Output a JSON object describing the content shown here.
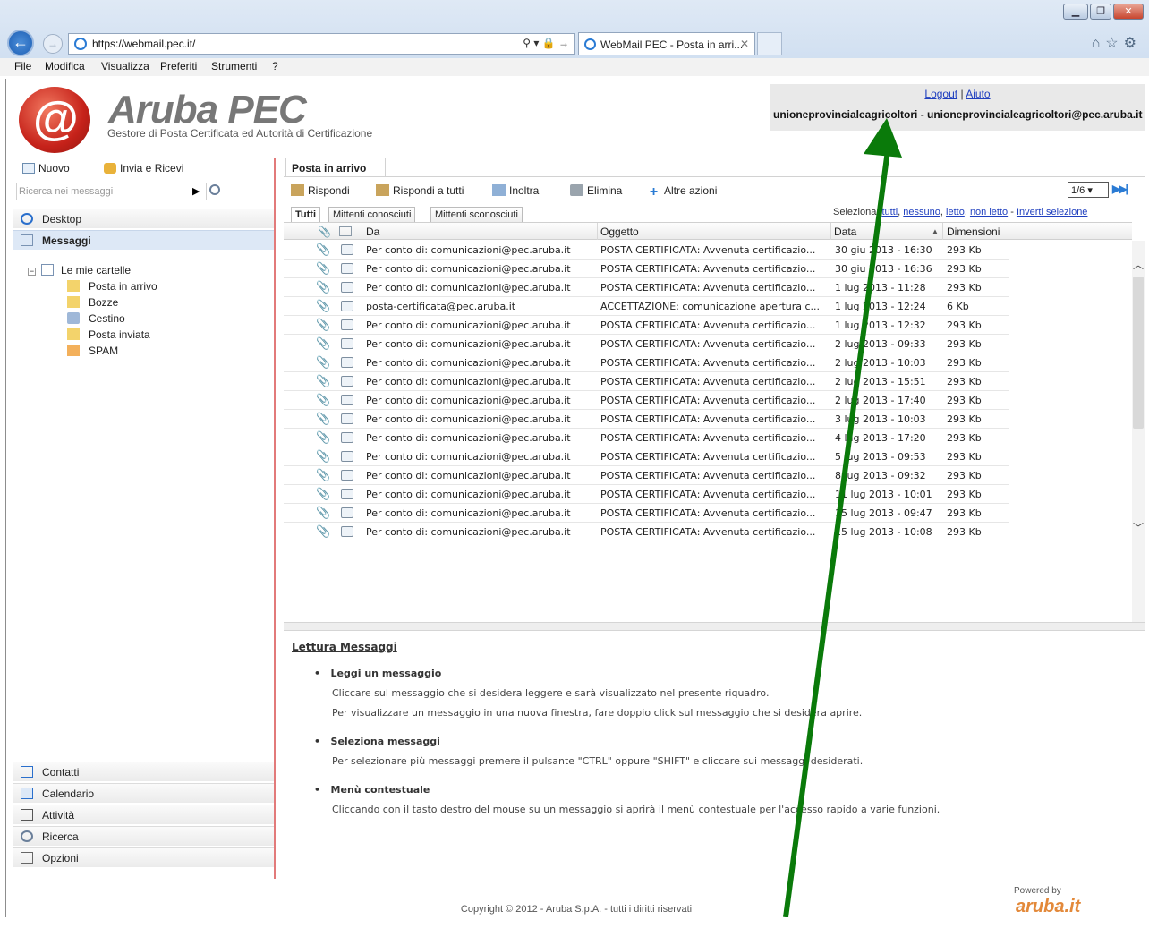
{
  "browser": {
    "url": "https://webmail.pec.it/",
    "addr_tools": "⚲ ▾ 🔒 →",
    "tab_title": "WebMail PEC - Posta in arri...",
    "tab_close": "✕",
    "right_icons": "⌂☆⚙",
    "win_min": "▁",
    "win_max": "❐",
    "win_close": "✕",
    "menu": [
      "File",
      "Modifica",
      "Visualizza",
      "Preferiti",
      "Strumenti",
      "?"
    ]
  },
  "logo": {
    "name": "Aruba PEC",
    "tagline": "Gestore di Posta Certificata ed Autorità di Certificazione"
  },
  "user": {
    "logout": "Logout",
    "sep": "|",
    "help": "Aiuto",
    "account": "unioneprovincialeagricoltori - unioneprovincialeagricoltori@pec.aruba.it"
  },
  "left": {
    "new_label": "Nuovo",
    "send_receive_label": "Invia e Ricevi",
    "search_placeholder": "Ricerca nei messaggi",
    "search_go": "▶",
    "nav_desktop": "Desktop",
    "nav_messaggi": "Messaggi",
    "tree_root": "Le mie cartelle",
    "folders": [
      "Posta in arrivo",
      "Bozze",
      "Cestino",
      "Posta inviata",
      "SPAM"
    ],
    "bottom_nav": [
      "Contatti",
      "Calendario",
      "Attività",
      "Ricerca",
      "Opzioni"
    ]
  },
  "main": {
    "tab": "Posta in arrivo",
    "toolbar": [
      "Rispondi",
      "Rispondi a tutti",
      "Inoltra",
      "Elimina",
      "Altre azioni"
    ],
    "pager": "1/6",
    "pager_select": "▾",
    "pager_next": "▶▶|",
    "subtabs": [
      "Tutti",
      "Mittenti conosciuti",
      "Mittenti sconosciuti"
    ],
    "select_prefix": "Seleziona:",
    "select_links": [
      "tutti",
      "nessuno",
      "letto",
      "non letto"
    ],
    "select_dash": "-",
    "invert": "Inverti selezione",
    "columns": {
      "from": "Da",
      "subject": "Oggetto",
      "date": "Data",
      "size": "Dimensioni",
      "sort": "▲"
    },
    "scroll_up": "︿",
    "scroll_down": "﹀"
  },
  "messages": [
    {
      "from": "Per conto di: comunicazioni@pec.aruba.it",
      "subject": "POSTA CERTIFICATA: Avvenuta certificazio...",
      "date": "30 giu 2013 - 16:30",
      "size": "293 Kb"
    },
    {
      "from": "Per conto di: comunicazioni@pec.aruba.it",
      "subject": "POSTA CERTIFICATA: Avvenuta certificazio...",
      "date": "30 giu 2013 - 16:36",
      "size": "293 Kb"
    },
    {
      "from": "Per conto di: comunicazioni@pec.aruba.it",
      "subject": "POSTA CERTIFICATA: Avvenuta certificazio...",
      "date": "1 lug 2013 - 11:28",
      "size": "293 Kb"
    },
    {
      "from": "posta-certificata@pec.aruba.it",
      "subject": "ACCETTAZIONE: comunicazione apertura c...",
      "date": "1 lug 2013 - 12:24",
      "size": "6 Kb"
    },
    {
      "from": "Per conto di: comunicazioni@pec.aruba.it",
      "subject": "POSTA CERTIFICATA: Avvenuta certificazio...",
      "date": "1 lug 2013 - 12:32",
      "size": "293 Kb"
    },
    {
      "from": "Per conto di: comunicazioni@pec.aruba.it",
      "subject": "POSTA CERTIFICATA: Avvenuta certificazio...",
      "date": "2 lug 2013 - 09:33",
      "size": "293 Kb"
    },
    {
      "from": "Per conto di: comunicazioni@pec.aruba.it",
      "subject": "POSTA CERTIFICATA: Avvenuta certificazio...",
      "date": "2 lug 2013 - 10:03",
      "size": "293 Kb"
    },
    {
      "from": "Per conto di: comunicazioni@pec.aruba.it",
      "subject": "POSTA CERTIFICATA: Avvenuta certificazio...",
      "date": "2 lug 2013 - 15:51",
      "size": "293 Kb"
    },
    {
      "from": "Per conto di: comunicazioni@pec.aruba.it",
      "subject": "POSTA CERTIFICATA: Avvenuta certificazio...",
      "date": "2 lug 2013 - 17:40",
      "size": "293 Kb"
    },
    {
      "from": "Per conto di: comunicazioni@pec.aruba.it",
      "subject": "POSTA CERTIFICATA: Avvenuta certificazio...",
      "date": "3 lug 2013 - 10:03",
      "size": "293 Kb"
    },
    {
      "from": "Per conto di: comunicazioni@pec.aruba.it",
      "subject": "POSTA CERTIFICATA: Avvenuta certificazio...",
      "date": "4 lug 2013 - 17:20",
      "size": "293 Kb"
    },
    {
      "from": "Per conto di: comunicazioni@pec.aruba.it",
      "subject": "POSTA CERTIFICATA: Avvenuta certificazio...",
      "date": "5 lug 2013 - 09:53",
      "size": "293 Kb"
    },
    {
      "from": "Per conto di: comunicazioni@pec.aruba.it",
      "subject": "POSTA CERTIFICATA: Avvenuta certificazio...",
      "date": "8 lug 2013 - 09:32",
      "size": "293 Kb"
    },
    {
      "from": "Per conto di: comunicazioni@pec.aruba.it",
      "subject": "POSTA CERTIFICATA: Avvenuta certificazio...",
      "date": "11 lug 2013 - 10:01",
      "size": "293 Kb"
    },
    {
      "from": "Per conto di: comunicazioni@pec.aruba.it",
      "subject": "POSTA CERTIFICATA: Avvenuta certificazio...",
      "date": "15 lug 2013 - 09:47",
      "size": "293 Kb"
    },
    {
      "from": "Per conto di: comunicazioni@pec.aruba.it",
      "subject": "POSTA CERTIFICATA: Avvenuta certificazio...",
      "date": "15 lug 2013 - 10:08",
      "size": "293 Kb"
    }
  ],
  "reading": {
    "title": "Lettura Messaggi",
    "sections": [
      {
        "heading": "Leggi un messaggio",
        "lines": [
          "Cliccare sul messaggio che si desidera leggere e sarà visualizzato nel presente riquadro.",
          "Per visualizzare un messaggio in una nuova finestra, fare doppio click sul messaggio che si desidera aprire."
        ]
      },
      {
        "heading": "Seleziona messaggi",
        "lines": [
          "Per selezionare più messaggi premere il pulsante \"CTRL\" oppure \"SHIFT\" e cliccare sui messaggi desiderati."
        ]
      },
      {
        "heading": "Menù contestuale",
        "lines": [
          "Cliccando con il tasto destro del mouse su un messaggio si aprirà il menù contestuale per l'accesso rapido a varie funzioni."
        ]
      }
    ]
  },
  "footer": {
    "copyright": "Copyright © 2012 - Aruba S.p.A. - tutti i diritti riservati",
    "powered": "Powered by",
    "brand": "aruba.it"
  },
  "colors": {
    "annotation_arrow": "#0a7a0a",
    "accent_red": "#e27a7a",
    "link": "#1f3fbf"
  }
}
